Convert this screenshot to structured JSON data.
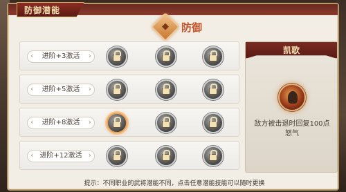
{
  "window": {
    "title": "防御潜能"
  },
  "section": {
    "title": "防御",
    "icon": "shield-icon"
  },
  "rows": [
    {
      "label": "进阶+3激活",
      "slots": [
        {
          "icon": "lock-icon",
          "active": false
        },
        {
          "icon": "lock-icon",
          "active": false
        },
        {
          "icon": "lock-icon",
          "active": false
        }
      ]
    },
    {
      "label": "进阶+5激活",
      "slots": [
        {
          "icon": "lock-icon",
          "active": false
        },
        {
          "icon": "lock-icon",
          "active": false
        },
        {
          "icon": "lock-icon",
          "active": false
        }
      ]
    },
    {
      "label": "进阶+8激活",
      "slots": [
        {
          "icon": "lock-icon",
          "active": true
        },
        {
          "icon": "lock-icon",
          "active": false
        },
        {
          "icon": "lock-icon",
          "active": false
        }
      ]
    },
    {
      "label": "进阶+12激活",
      "slots": [
        {
          "icon": "lock-icon",
          "active": false
        },
        {
          "icon": "lock-icon",
          "active": false
        },
        {
          "icon": "lock-icon",
          "active": false
        }
      ]
    }
  ],
  "skill_panel": {
    "title": "凯歌",
    "icon": "warrior-portrait-icon",
    "description": "敌方被击退时回复100点怒气"
  },
  "tip": "提示：不同职业的武将潜能不同，点击任意潜能技能可以随时更换",
  "colors": {
    "accent": "#c4552a",
    "header": "#7b2b22",
    "panel_bg": "#f2eee6"
  }
}
